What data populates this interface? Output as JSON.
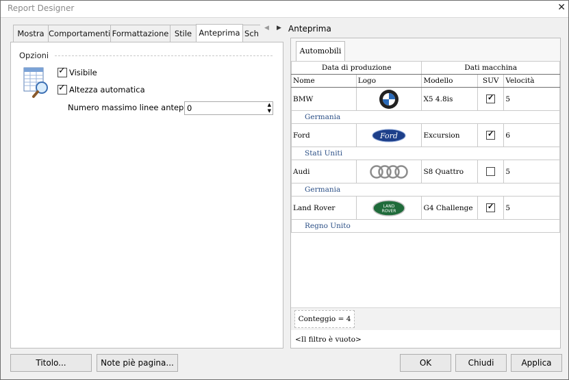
{
  "window": {
    "title": "Report Designer"
  },
  "tabs": [
    "Mostra",
    "Comportamenti",
    "Formattazione",
    "Stile",
    "Anteprima",
    "Sch"
  ],
  "options": {
    "group_label": "Opzioni",
    "visible_label": "Visibile",
    "auto_height_label": "Altezza automatica",
    "max_lines_label": "Numero massimo linee anteprima:",
    "max_lines_value": "0"
  },
  "preview": {
    "label": "Anteprima",
    "tab": "Automobili",
    "band1": "Data di produzione",
    "band2": "Dati macchina",
    "columns": [
      "Nome",
      "Logo",
      "Modello",
      "SUV",
      "Velocità"
    ],
    "rows": [
      {
        "name": "BMW",
        "logo": "bmw-logo",
        "model": "X5 4.8is",
        "suv": true,
        "speed": "5",
        "country": "Germania"
      },
      {
        "name": "Ford",
        "logo": "ford-logo",
        "model": "Excursion",
        "suv": true,
        "speed": "6",
        "country": "Stati Uniti"
      },
      {
        "name": "Audi",
        "logo": "audi-logo",
        "model": "S8 Quattro",
        "suv": false,
        "speed": "5",
        "country": "Germania"
      },
      {
        "name": "Land Rover",
        "logo": "land-rover-logo",
        "model": "G4 Challenge",
        "suv": true,
        "speed": "5",
        "country": "Regno Unito"
      }
    ],
    "count": "Conteggio = 4",
    "filter": "<Il filtro è vuoto>",
    "logo_text": {
      "ford": "Ford",
      "landrover_top": "LAND",
      "landrover_bottom": "ROVER"
    }
  },
  "buttons": {
    "title": "Titolo...",
    "footnotes": "Note piè pagina...",
    "ok": "OK",
    "close": "Chiudi",
    "apply": "Applica"
  },
  "colors": {
    "group_text": "#2b4f86",
    "ford_blue": "#1d3f8a",
    "landrover_green": "#1f6b3a"
  }
}
